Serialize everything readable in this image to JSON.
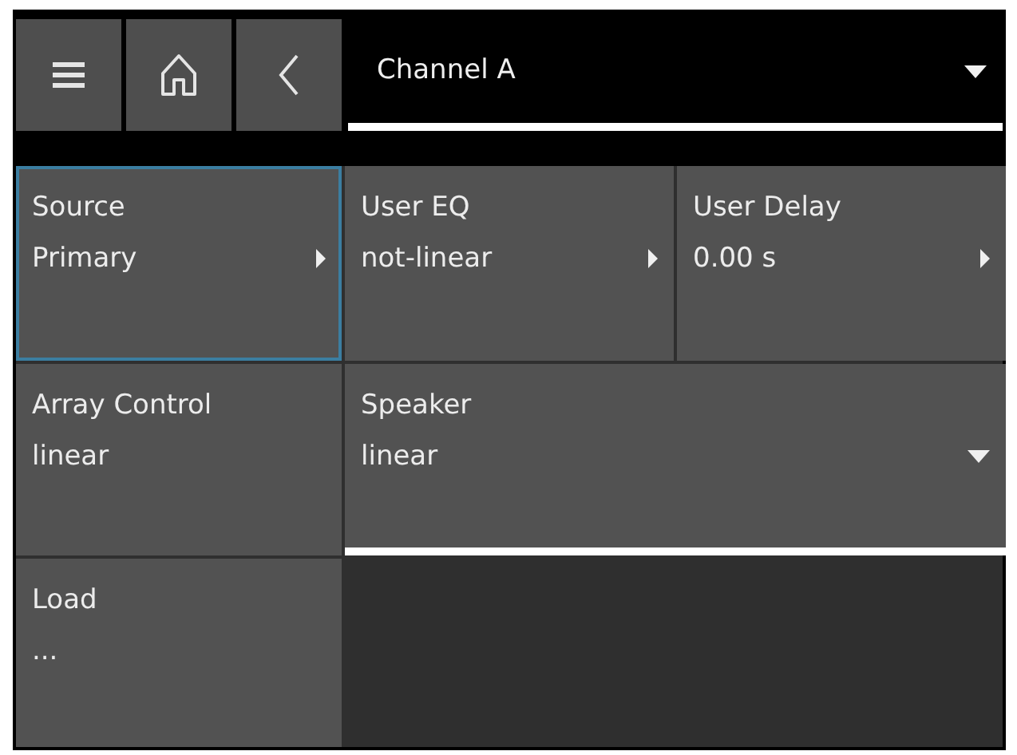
{
  "header": {
    "buttons": [
      {
        "kind": "menu"
      },
      {
        "kind": "home"
      },
      {
        "kind": "back"
      }
    ],
    "channel_select": {
      "value": "Channel A"
    }
  },
  "tiles": [
    {
      "kind": "submenu",
      "label": "Source",
      "value": "Primary",
      "selected": true
    },
    {
      "kind": "submenu",
      "label": "User EQ",
      "value": "not-linear",
      "selected": false
    },
    {
      "kind": "submenu",
      "label": "User Delay",
      "value": "0.00 s",
      "selected": false
    },
    {
      "kind": "plain",
      "label": "Array Control",
      "value": "linear",
      "selected": false
    },
    {
      "kind": "dropdown",
      "label": "Speaker",
      "value": "linear",
      "selected": false
    },
    {
      "kind": "plain",
      "label": "Load",
      "value": "...",
      "selected": false
    }
  ]
}
